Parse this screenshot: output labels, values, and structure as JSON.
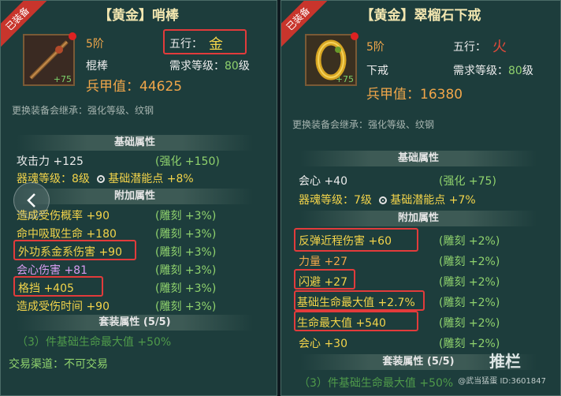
{
  "left": {
    "badge": "已装备",
    "title": "【黄金】哨棒",
    "tier": "5阶",
    "element_label": "五行：",
    "element_value": "金",
    "type": "棍棒",
    "req_label": "需求等级：",
    "req_value": "80",
    "req_unit": "级",
    "plus": "+75",
    "power_label": "兵甲值：",
    "power_value": "44625",
    "inherit": "更换装备会继承：强化等级、纹钢",
    "base_title": "基础属性",
    "base": {
      "attack": "攻击力 +125",
      "attack_bonus": "(强化 +150)",
      "soul": "器魂等级：8级",
      "soul_bonus": "基础潜能点 +8%"
    },
    "extra_title": "附加属性",
    "extra": [
      {
        "name": "造成受伤概率 +90",
        "bonus": "(雕刻 +3%)"
      },
      {
        "name": "命中吸取生命 +180",
        "bonus": "(雕刻 +3%)"
      },
      {
        "name": "外功系金系伤害 +90",
        "bonus": "(雕刻 +3%)"
      },
      {
        "name": "会心伤害 +81",
        "bonus": "(雕刻 +3%)"
      },
      {
        "name": "格挡 +405",
        "bonus": "(雕刻 +3%)"
      },
      {
        "name": "造成受伤时间 +90",
        "bonus": "(雕刻 +3%)"
      }
    ],
    "set_title": "套装属性 (5/5)",
    "set_effect": "（3）件基础生命最大值 +50%",
    "trade": "交易渠道：不可交易"
  },
  "right": {
    "badge": "已装备",
    "title": "【黄金】翠榴石下戒",
    "tier": "5阶",
    "element_label": "五行：",
    "element_value": "火",
    "type": "下戒",
    "req_label": "需求等级：",
    "req_value": "80",
    "req_unit": "级",
    "plus": "+75",
    "power_label": "兵甲值：",
    "power_value": "16380",
    "inherit": "更换装备会继承：强化等级、纹钢",
    "base_title": "基础属性",
    "base": {
      "crit": "会心 +40",
      "crit_bonus": "(强化 +75)",
      "soul": "器魂等级：7级",
      "soul_bonus": "基础潜能点 +7%"
    },
    "extra_title": "附加属性",
    "extra": [
      {
        "name": "反弹近程伤害 +60",
        "bonus": "(雕刻 +2%)"
      },
      {
        "name": "力量 +27",
        "bonus": "(雕刻 +2%)"
      },
      {
        "name": "闪避 +27",
        "bonus": "(雕刻 +2%)"
      },
      {
        "name": "基础生命最大值 +2.7%",
        "bonus": "(雕刻 +2%)"
      },
      {
        "name": "生命最大值 +540",
        "bonus": "(雕刻 +2%)"
      },
      {
        "name": "会心 +30",
        "bonus": "(雕刻 +2%)"
      }
    ],
    "set_title": "套装属性 (5/5)",
    "set_effect": "（3）件基础生命最大值 +50%",
    "watermark": "推栏",
    "watermark_id": "@武当猛蛋 ID:3601847"
  },
  "icons": {
    "back": "chevron-left-icon"
  }
}
